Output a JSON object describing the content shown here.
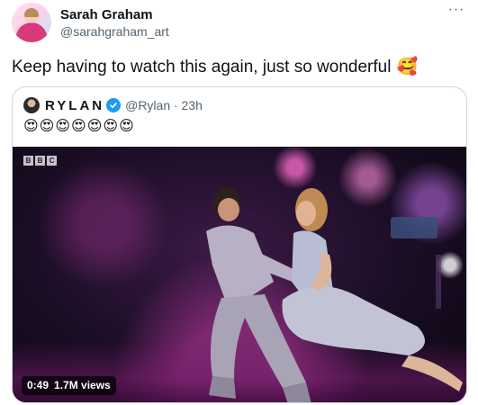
{
  "tweet": {
    "author_name": "Sarah Graham",
    "author_handle": "@sarahgraham_art",
    "more_label": "···",
    "text": "Keep having to watch this again, just so wonderful",
    "text_emoji": "🥰"
  },
  "quoted": {
    "name": "RYLAN",
    "handle_time": "@Rylan · 23h",
    "text": "😍😍😍😍😍😍😍",
    "video": {
      "channel_logo": [
        "B",
        "B",
        "C"
      ],
      "duration": "0:49",
      "views": "1.7M views"
    }
  },
  "colors": {
    "verified": "#1d9bf0",
    "secondary_text": "#536471",
    "border": "#cfd9de"
  }
}
